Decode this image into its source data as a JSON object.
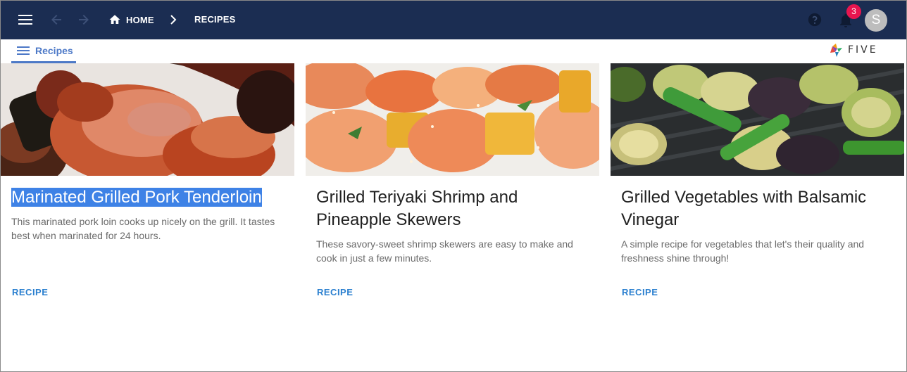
{
  "header": {
    "breadcrumb": {
      "home": "HOME",
      "current": "RECIPES"
    },
    "notifications_count": "3",
    "avatar_initial": "S",
    "colors": {
      "bar": "#1b2d52",
      "badge": "#e8154f",
      "avatar": "#bdbdbd"
    }
  },
  "subheader": {
    "menu_label": "Recipes",
    "logo_text": "FIVE",
    "accent": "#4d79c7"
  },
  "cards": [
    {
      "title": "Marinated Grilled Pork Tenderloin",
      "title_selected": true,
      "description": "This marinated pork loin cooks up nicely on the grill. It tastes best when marinated for 24 hours.",
      "action": "RECIPE",
      "image_icon": "grilled-pork-photo"
    },
    {
      "title": "Grilled Teriyaki Shrimp and Pineapple Skewers",
      "title_selected": false,
      "description": "These savory-sweet shrimp skewers are easy to make and cook in just a few minutes.",
      "action": "RECIPE",
      "image_icon": "shrimp-skewers-photo"
    },
    {
      "title": "Grilled Vegetables with Balsamic Vinegar",
      "title_selected": false,
      "description": "A simple recipe for vegetables that let's their quality and freshness shine through!",
      "action": "RECIPE",
      "image_icon": "grilled-vegetables-photo"
    }
  ],
  "icons": [
    "menu-icon",
    "arrow-back-icon",
    "arrow-forward-icon",
    "home-icon",
    "chevron-right-icon",
    "help-icon",
    "bell-icon",
    "five-logo-icon"
  ]
}
